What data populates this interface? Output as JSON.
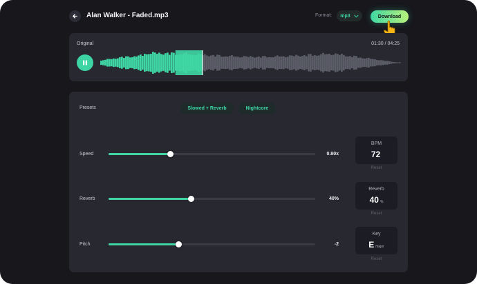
{
  "header": {
    "file_title": "Alan Walker - Faded.mp3",
    "format_label": "Format:",
    "format_value": "mp3",
    "download_label": "Download"
  },
  "player": {
    "label": "Original",
    "time": "01:30 / 04:25",
    "progress_fraction": 0.34
  },
  "presets": {
    "label": "Presets",
    "items": [
      "Slowed + Reverb",
      "Nightcore"
    ]
  },
  "controls": [
    {
      "label": "Speed",
      "value": "0.80x",
      "fraction": 0.3
    },
    {
      "label": "Reverb",
      "value": "40%",
      "fraction": 0.4
    },
    {
      "label": "Pitch",
      "value": "-2",
      "fraction": 0.34
    }
  ],
  "info": [
    {
      "title": "BPM",
      "value": "72",
      "unit": "",
      "reset": "Reset"
    },
    {
      "title": "Reverb",
      "value": "40",
      "unit": "%",
      "reset": "Reset"
    },
    {
      "title": "Key",
      "value": "E",
      "unit": "major",
      "reset": "Reset"
    }
  ],
  "colors": {
    "accent": "#3fd6a4",
    "accent_end": "#b8f07b",
    "panel": "#272830",
    "background": "#17171c"
  },
  "icons": {
    "back": "arrow-left-icon",
    "play_state": "pause-icon",
    "format_dropdown": "chevron-down-icon",
    "cursor": "hand-pointer-icon"
  }
}
